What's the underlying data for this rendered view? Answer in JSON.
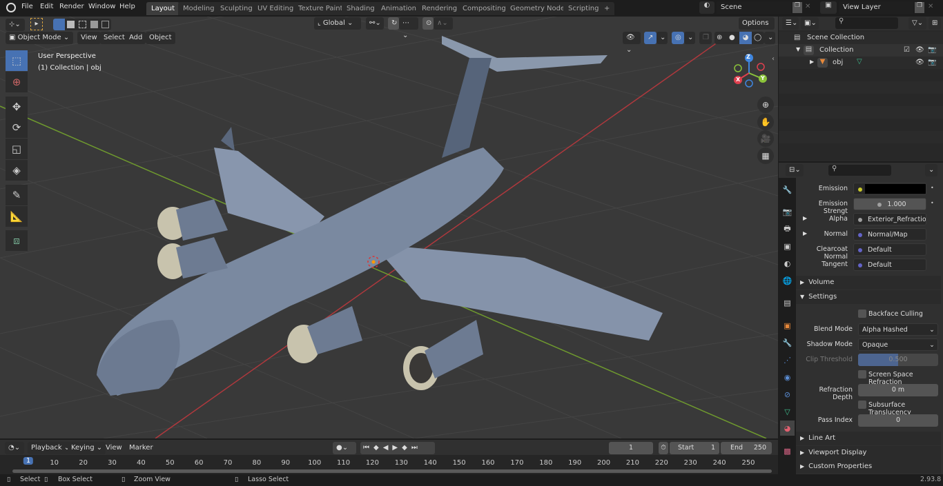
{
  "app_menu": [
    "File",
    "Edit",
    "Render",
    "Window",
    "Help"
  ],
  "workspace_tabs": [
    "Layout",
    "Modeling",
    "Sculpting",
    "UV Editing",
    "Texture Paint",
    "Shading",
    "Animation",
    "Rendering",
    "Compositing",
    "Geometry Nodes",
    "Scripting"
  ],
  "active_workspace": "Layout",
  "add_workspace": "+",
  "scene": {
    "name": "Scene",
    "view_layer": "View Layer"
  },
  "viewport": {
    "mode": "Object Mode",
    "menus": [
      "View",
      "Select",
      "Add",
      "Object"
    ],
    "transform_orientation": "Global",
    "options_label": "Options",
    "overlay_title": "User Perspective",
    "overlay_subtitle": "(1) Collection | obj",
    "gizmo_axes": {
      "x": "X",
      "y": "Y",
      "z": "Z"
    },
    "colors": {
      "x_axis": "#e0404f",
      "y_axis": "#8bc33a",
      "z_axis": "#3f86e0",
      "accent": "#4772b3"
    }
  },
  "toolbar_tools": [
    "select-box",
    "cursor",
    "move",
    "rotate",
    "scale",
    "transform",
    "annotate",
    "measure",
    "add-cube"
  ],
  "outliner": {
    "search_placeholder": "",
    "rows": [
      {
        "label": "Scene Collection",
        "level": 0
      },
      {
        "label": "Collection",
        "level": 1
      },
      {
        "label": "obj",
        "level": 2
      }
    ]
  },
  "properties": {
    "inputs": [
      {
        "label": "Emission",
        "value": "",
        "socket": "#c8c82a"
      },
      {
        "label": "Emission Strengt",
        "value": "1.000",
        "socket": "#a0a0a0"
      },
      {
        "label": "Alpha",
        "value": "Exterior_Refraction_...",
        "socket": "#a0a0a0",
        "expand": true
      },
      {
        "label": "Normal",
        "value": "Normal/Map",
        "socket": "#6363c7",
        "expand": true
      },
      {
        "label": "Clearcoat Normal",
        "value": "Default",
        "socket": "#6363c7"
      },
      {
        "label": "Tangent",
        "value": "Default",
        "socket": "#6363c7"
      }
    ],
    "panels": {
      "volume": "Volume",
      "settings": "Settings",
      "line_art": "Line Art",
      "viewport_display": "Viewport Display",
      "custom_properties": "Custom Properties"
    },
    "settings": {
      "backface_culling": "Backface Culling",
      "blend_mode_label": "Blend Mode",
      "blend_mode": "Alpha Hashed",
      "shadow_mode_label": "Shadow Mode",
      "shadow_mode": "Opaque",
      "clip_threshold_label": "Clip Threshold",
      "clip_threshold": "0.500",
      "clip_threshold_fraction": 0.5,
      "ssr": "Screen Space Refraction",
      "refraction_depth_label": "Refraction Depth",
      "refraction_depth": "0 m",
      "subsurface": "Subsurface Translucency",
      "pass_index_label": "Pass Index",
      "pass_index": "0"
    }
  },
  "timeline": {
    "menus": [
      "Playback",
      "Keying",
      "View",
      "Marker"
    ],
    "current_frame": "1",
    "start_label": "Start",
    "start": "1",
    "end_label": "End",
    "end": "250",
    "ticks": [
      "1",
      "10",
      "20",
      "30",
      "40",
      "50",
      "60",
      "70",
      "80",
      "90",
      "100",
      "110",
      "120",
      "130",
      "140",
      "150",
      "160",
      "170",
      "180",
      "190",
      "200",
      "210",
      "220",
      "230",
      "240",
      "250"
    ]
  },
  "statusbar": {
    "select": "Select",
    "box_select": "Box Select",
    "zoom_view": "Zoom View",
    "lasso_select": "Lasso Select",
    "version": "2.93.8"
  }
}
